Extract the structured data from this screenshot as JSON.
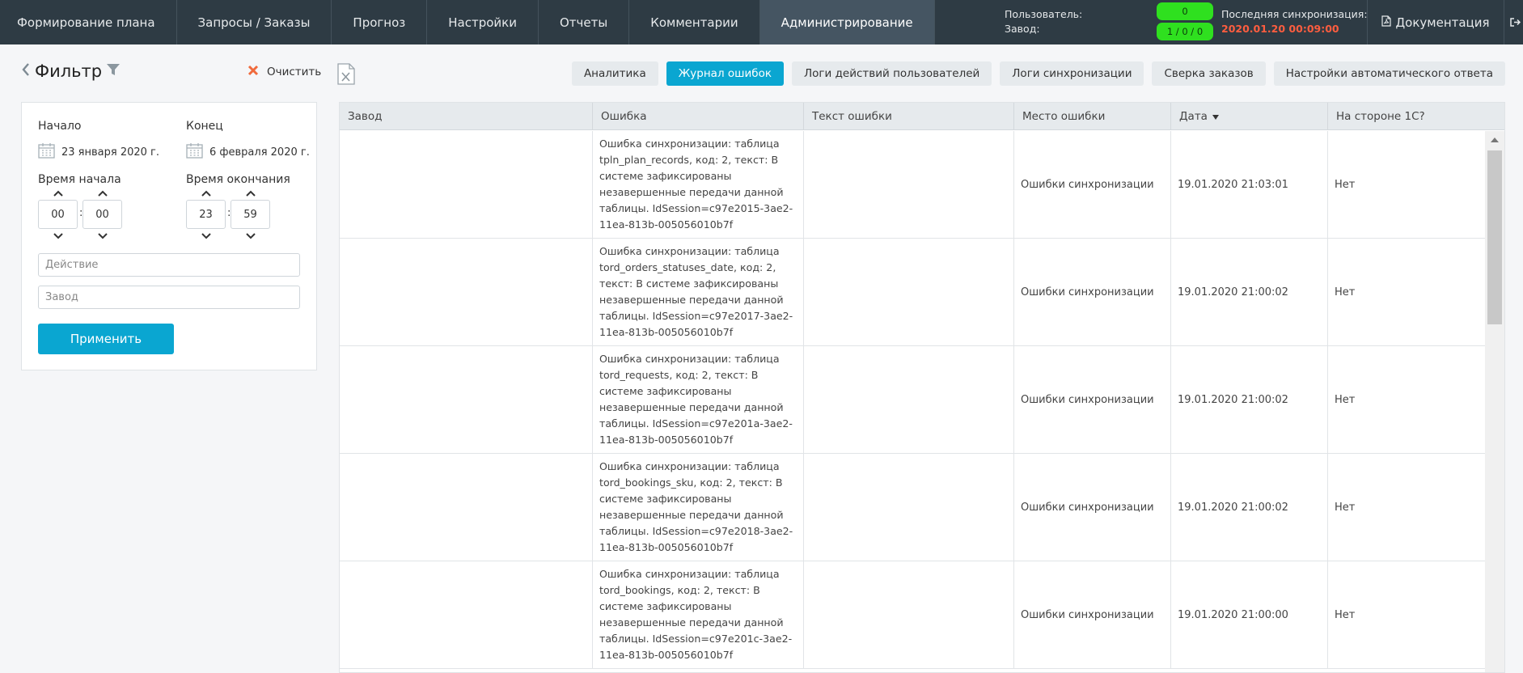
{
  "nav": {
    "items": [
      {
        "label": "Формирование плана",
        "active": false
      },
      {
        "label": "Запросы / Заказы",
        "active": false
      },
      {
        "label": "Прогноз",
        "active": false
      },
      {
        "label": "Настройки",
        "active": false
      },
      {
        "label": "Отчеты",
        "active": false
      },
      {
        "label": "Комментарии",
        "active": false
      },
      {
        "label": "Администрирование",
        "active": true
      }
    ],
    "user_label": "Пользователь:",
    "plant_label": "Завод:",
    "badge_top": "0",
    "badge_bottom": "1 / 0 / 0",
    "sync_label": "Последняя синхронизация:",
    "sync_date": "2020.01.20 00:09:00",
    "docs_label": "Документация",
    "badge_color": "#2fe01f",
    "sync_date_color": "#ff5d3f"
  },
  "filter": {
    "title": "Фильтр",
    "clear_label": "Очистить",
    "start_label": "Начало",
    "end_label": "Конец",
    "start_date": "23 января 2020 г.",
    "end_date": "6 февраля 2020 г.",
    "start_time_label": "Время начала",
    "end_time_label": "Время окончания",
    "start_hour": "00",
    "start_min": "00",
    "end_hour": "23",
    "end_min": "59",
    "action_placeholder": "Действие",
    "plant_placeholder": "Завод",
    "apply_label": "Применить"
  },
  "tabs": [
    {
      "label": "Аналитика",
      "active": false
    },
    {
      "label": "Журнал ошибок",
      "active": true
    },
    {
      "label": "Логи действий пользователей",
      "active": false
    },
    {
      "label": "Логи синхронизации",
      "active": false
    },
    {
      "label": "Сверка заказов",
      "active": false
    },
    {
      "label": "Настройки автоматического ответа",
      "active": false
    }
  ],
  "table": {
    "columns": [
      "Завод",
      "Ошибка",
      "Текст ошибки",
      "Место ошибки",
      "Дата",
      "На стороне 1С?"
    ],
    "sorted_column": "Дата",
    "rows": [
      {
        "plant": "",
        "error": "Ошибка синхронизации: таблица tpln_plan_records, код: 2, текст: В системе зафиксированы незавершенные передачи данной таблицы. IdSession=c97e2015-3ae2-11ea-813b-005056010b7f",
        "text": "",
        "place": "Ошибки синхронизации",
        "date": "19.01.2020 21:03:01",
        "side": "Нет"
      },
      {
        "plant": "",
        "error": "Ошибка синхронизации: таблица tord_orders_statuses_date, код: 2, текст: В системе зафиксированы незавершенные передачи данной таблицы. IdSession=c97e2017-3ae2-11ea-813b-005056010b7f",
        "text": "",
        "place": "Ошибки синхронизации",
        "date": "19.01.2020 21:00:02",
        "side": "Нет"
      },
      {
        "plant": "",
        "error": "Ошибка синхронизации: таблица tord_requests, код: 2, текст: В системе зафиксированы незавершенные передачи данной таблицы. IdSession=c97e201a-3ae2-11ea-813b-005056010b7f",
        "text": "",
        "place": "Ошибки синхронизации",
        "date": "19.01.2020 21:00:02",
        "side": "Нет"
      },
      {
        "plant": "",
        "error": "Ошибка синхронизации: таблица tord_bookings_sku, код: 2, текст: В системе зафиксированы незавершенные передачи данной таблицы. IdSession=c97e2018-3ae2-11ea-813b-005056010b7f",
        "text": "",
        "place": "Ошибки синхронизации",
        "date": "19.01.2020 21:00:02",
        "side": "Нет"
      },
      {
        "plant": "",
        "error": "Ошибка синхронизации: таблица tord_bookings, код: 2, текст: В системе зафиксированы незавершенные передачи данной таблицы. IdSession=c97e201c-3ae2-11ea-813b-005056010b7f",
        "text": "",
        "place": "Ошибки синхронизации",
        "date": "19.01.2020 21:00:00",
        "side": "Нет"
      }
    ]
  },
  "colors": {
    "nav_bg": "#2e3b44",
    "accent": "#0aa6d1",
    "clear_icon": "#f06a3c"
  },
  "icons": {
    "back": "chevron-left-icon",
    "filter": "funnel-icon",
    "clear": "cross-icon",
    "excel": "excel-icon",
    "calendar": "calendar-icon",
    "docs": "pdf-file-icon",
    "logout": "logout-icon",
    "sort": "sort-desc-icon"
  }
}
